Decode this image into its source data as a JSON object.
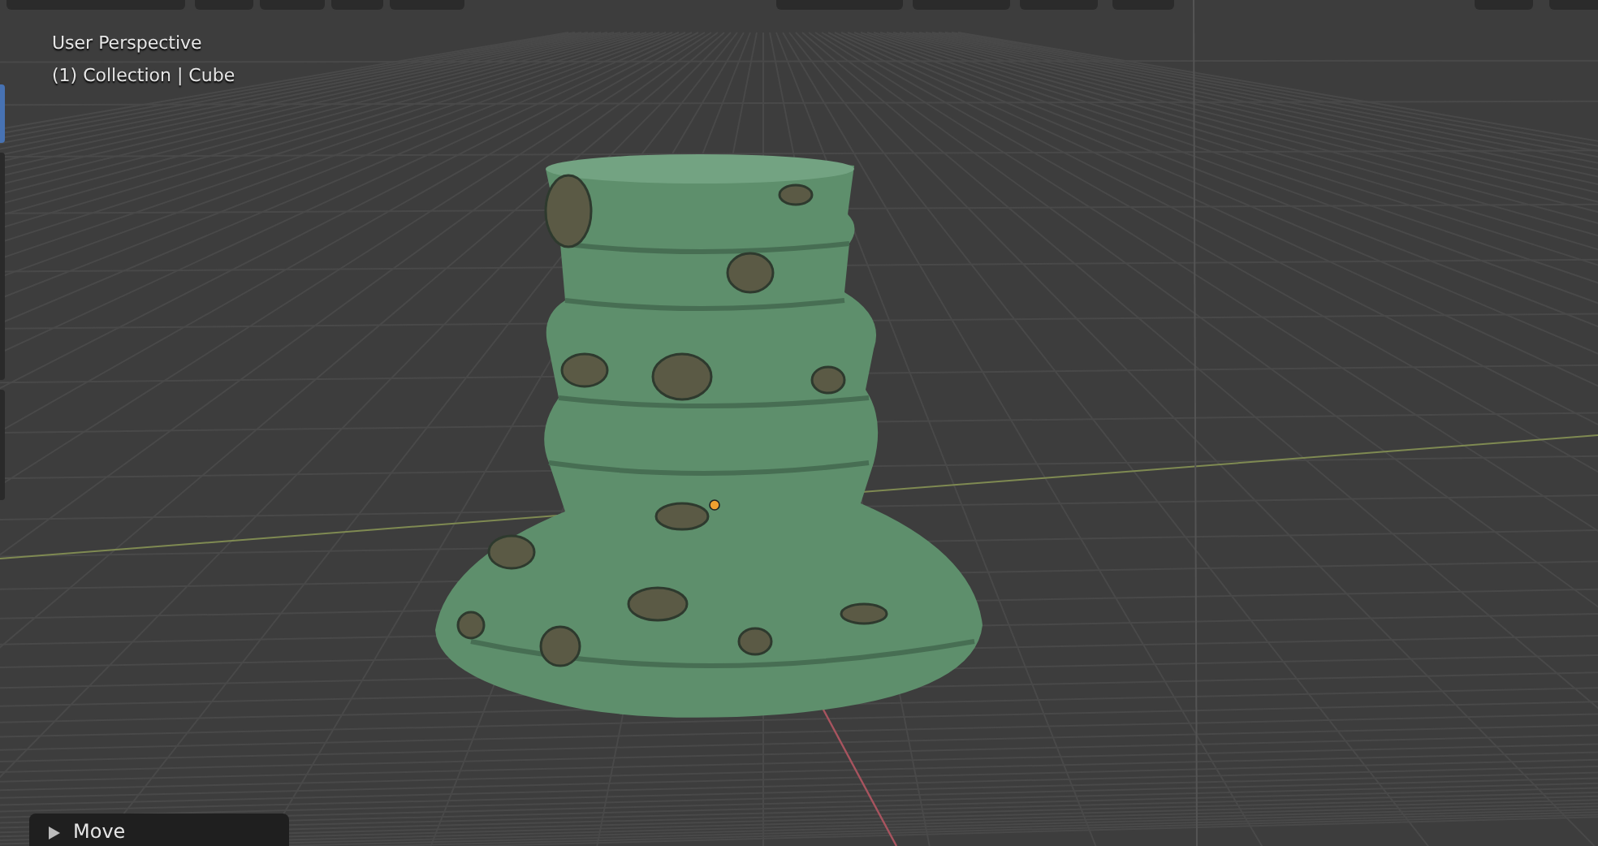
{
  "viewport": {
    "view_name": "User Perspective",
    "object_info": "(1) Collection | Cube"
  },
  "last_operator_panel": {
    "label": "Move",
    "expanded": false
  }
}
